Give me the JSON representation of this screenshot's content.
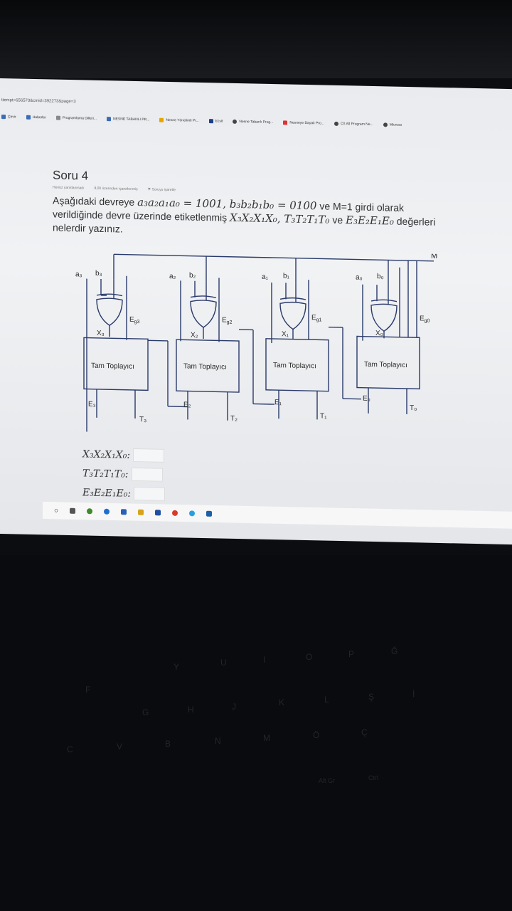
{
  "browser": {
    "url_fragment": "ttempt=656570&cmid=392273&page=3",
    "bookmarks": [
      "Çevir",
      "Haberler",
      "Programlama Dilleri...",
      "NESNE TABANLI PR...",
      "Nesne Yönelimli Pr...",
      "b1sit",
      "Nesne Tabanlı Prog...",
      "Nesneye Dayalı Pro...",
      "C# Alt Program Ne...",
      "Microso"
    ]
  },
  "question": {
    "title": "Soru 4",
    "status": "Henüz yanıtlanmadı",
    "points": "8,00 üzerinden işaretlenmiş",
    "flag_label": "Soruyu işaretle",
    "text_part1": "Aşağıdaki devreye",
    "math1": "a₃a₂a₁a₀ = 1001, b₃b₂b₁b₀ = 0100",
    "text_part2": "ve M=1 girdi olarak verildiğinde devre üzerinde etiketlenmiş",
    "math2": "X₃X₂X₁X₀, T₃T₂T₁T₀",
    "text_part3": "ve",
    "math3": "E₃E₂E₁E₀",
    "text_part4": "değerleri nelerdir yazınız."
  },
  "circuit": {
    "m_label": "M",
    "blocks": [
      {
        "a": "a₃",
        "b": "b₃",
        "x": "X₃",
        "eg": "E",
        "eg_sub": "g3",
        "adder": "Tam Toplayıcı",
        "e": "E₃",
        "t": "T₃"
      },
      {
        "a": "a₂",
        "b": "b₂",
        "x": "X₂",
        "eg": "E",
        "eg_sub": "g2",
        "adder": "Tam Toplayıcı",
        "e": "E₂",
        "t": "T₂"
      },
      {
        "a": "a₁",
        "b": "b₁",
        "x": "X₁",
        "eg": "E",
        "eg_sub": "g1",
        "adder": "Tam Toplayıcı",
        "e": "E₁",
        "t": "T₁"
      },
      {
        "a": "a₀",
        "b": "b₀",
        "x": "X₀",
        "eg": "E",
        "eg_sub": "g0",
        "adder": "Tam Toplayıcı",
        "e": "E₀",
        "t": "T₀"
      }
    ]
  },
  "answers": [
    {
      "label": "X₃X₂X₁X₀:",
      "value": ""
    },
    {
      "label": "T₃T₂T₁T₀:",
      "value": ""
    },
    {
      "label": "E₃E₂E₁E₀:",
      "value": ""
    }
  ],
  "keyboard": {
    "row1": [
      "Y",
      "U",
      "I",
      "O",
      "P",
      "Ğ"
    ],
    "row2": [
      "F",
      "G",
      "H",
      "J",
      "K",
      "L",
      "Ş",
      "İ"
    ],
    "row3": [
      "C",
      "V",
      "B",
      "N",
      "M",
      "Ö",
      "Ç"
    ],
    "row4": [
      "Alt Gr",
      "Ctrl"
    ]
  }
}
